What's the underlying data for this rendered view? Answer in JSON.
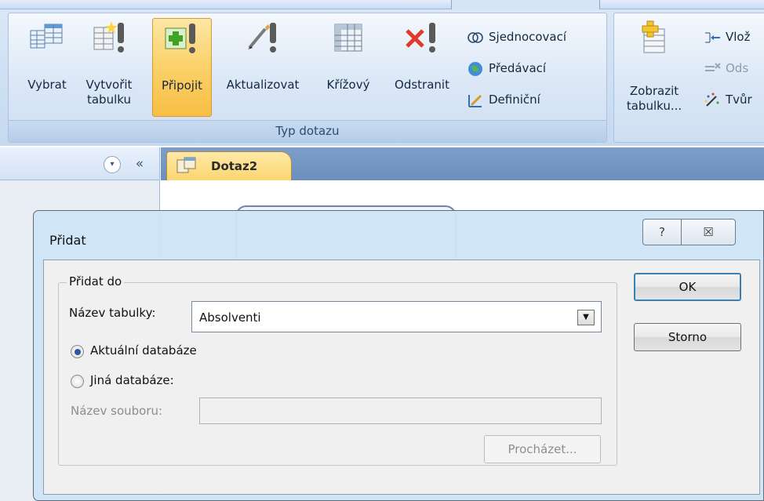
{
  "ribbon": {
    "group_caption": "Typ dotazu",
    "buttons": {
      "select": "Vybrat",
      "make_table_1": "Vytvořit",
      "make_table_2": "tabulku",
      "append": "Připojit",
      "update": "Aktualizovat",
      "crosstab": "Křížový",
      "delete": "Odstranit"
    },
    "small_cmds": {
      "union": "Sjednocovací",
      "passthrough": "Předávací",
      "definition": "Definiční"
    },
    "show_table_1": "Zobrazit",
    "show_table_2": "tabulku...",
    "insert_rows": "Vlož",
    "delete_rows": "Ods",
    "builder": "Tvůr"
  },
  "nav": {
    "collapse": "«",
    "dropdown": "▾"
  },
  "doc_tab": {
    "label": "Dotaz2"
  },
  "dialog": {
    "title": "Přidat",
    "help": "?",
    "close": "☒",
    "group_label": "Přidat do",
    "table_name_label": "Název tabulky:",
    "table_name_value": "Absolventi",
    "radio_current": "Aktuální databáze",
    "radio_other": "Jiná databáze:",
    "file_name_label": "Název souboru:",
    "file_name_value": "",
    "browse": "Procházet...",
    "ok": "OK",
    "cancel": "Storno"
  },
  "colors": {
    "ribbon_bg": "#dbe8f7",
    "active_button": "#fbd36e",
    "tabstrip": "#7d9ec9",
    "dialog_frame": "#cee4f6"
  }
}
